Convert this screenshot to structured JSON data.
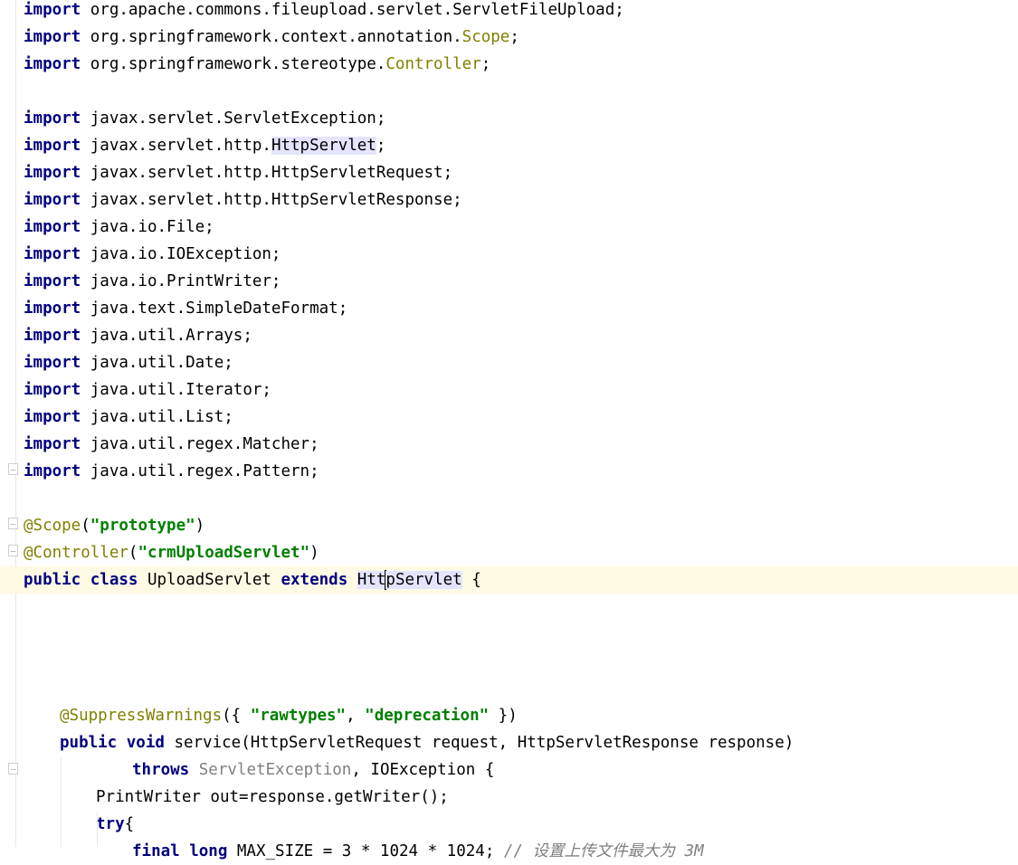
{
  "editor": {
    "language": "java",
    "lines": [
      {
        "indent": 0,
        "tokens": [
          {
            "t": "import",
            "c": "kw"
          },
          {
            "t": " org.apache.commons.fileupload.servlet.ServletFileUpload;"
          }
        ]
      },
      {
        "indent": 0,
        "tokens": [
          {
            "t": "import",
            "c": "kw"
          },
          {
            "t": " org.springframework.context.annotation."
          },
          {
            "t": "Scope",
            "c": "cls"
          },
          {
            "t": ";"
          }
        ]
      },
      {
        "indent": 0,
        "tokens": [
          {
            "t": "import",
            "c": "kw"
          },
          {
            "t": " org.springframework.stereotype."
          },
          {
            "t": "Controller",
            "c": "cls"
          },
          {
            "t": ";"
          }
        ]
      },
      {
        "indent": 0,
        "tokens": []
      },
      {
        "indent": 0,
        "tokens": [
          {
            "t": "import",
            "c": "kw"
          },
          {
            "t": " javax.servlet.ServletException;"
          }
        ]
      },
      {
        "indent": 0,
        "tokens": [
          {
            "t": "import",
            "c": "kw"
          },
          {
            "t": " javax.servlet.http."
          },
          {
            "t": "HttpServlet",
            "c": "hl"
          },
          {
            "t": ";"
          }
        ]
      },
      {
        "indent": 0,
        "tokens": [
          {
            "t": "import",
            "c": "kw"
          },
          {
            "t": " javax.servlet.http.HttpServletRequest;"
          }
        ]
      },
      {
        "indent": 0,
        "tokens": [
          {
            "t": "import",
            "c": "kw"
          },
          {
            "t": " javax.servlet.http.HttpServletResponse;"
          }
        ]
      },
      {
        "indent": 0,
        "tokens": [
          {
            "t": "import",
            "c": "kw"
          },
          {
            "t": " java.io.File;"
          }
        ]
      },
      {
        "indent": 0,
        "tokens": [
          {
            "t": "import",
            "c": "kw"
          },
          {
            "t": " java.io.IOException;"
          }
        ]
      },
      {
        "indent": 0,
        "tokens": [
          {
            "t": "import",
            "c": "kw"
          },
          {
            "t": " java.io.PrintWriter;"
          }
        ]
      },
      {
        "indent": 0,
        "tokens": [
          {
            "t": "import",
            "c": "kw"
          },
          {
            "t": " java.text.SimpleDateFormat;"
          }
        ]
      },
      {
        "indent": 0,
        "tokens": [
          {
            "t": "import",
            "c": "kw"
          },
          {
            "t": " java.util.Arrays;"
          }
        ]
      },
      {
        "indent": 0,
        "tokens": [
          {
            "t": "import",
            "c": "kw"
          },
          {
            "t": " java.util.Date;"
          }
        ]
      },
      {
        "indent": 0,
        "tokens": [
          {
            "t": "import",
            "c": "kw"
          },
          {
            "t": " java.util.Iterator;"
          }
        ]
      },
      {
        "indent": 0,
        "tokens": [
          {
            "t": "import",
            "c": "kw"
          },
          {
            "t": " java.util.List;"
          }
        ]
      },
      {
        "indent": 0,
        "tokens": [
          {
            "t": "import",
            "c": "kw"
          },
          {
            "t": " java.util.regex.Matcher;"
          }
        ]
      },
      {
        "indent": 0,
        "tokens": [
          {
            "t": "import",
            "c": "kw"
          },
          {
            "t": " java.util.regex.Pattern;"
          }
        ]
      },
      {
        "indent": 0,
        "tokens": []
      },
      {
        "indent": 0,
        "tokens": [
          {
            "t": "@Scope",
            "c": "ann"
          },
          {
            "t": "("
          },
          {
            "t": "\"prototype\"",
            "c": "str"
          },
          {
            "t": ")"
          }
        ]
      },
      {
        "indent": 0,
        "tokens": [
          {
            "t": "@Controller",
            "c": "ann"
          },
          {
            "t": "("
          },
          {
            "t": "\"crmUploadServlet\"",
            "c": "str"
          },
          {
            "t": ")"
          }
        ]
      },
      {
        "indent": 0,
        "current": true,
        "tokens": [
          {
            "t": "public class",
            "c": "kw"
          },
          {
            "t": " UploadServlet "
          },
          {
            "t": "extends",
            "c": "kw"
          },
          {
            "t": " "
          },
          {
            "t": "Htt",
            "c": "hl"
          },
          {
            "caret": true
          },
          {
            "t": "pServlet",
            "c": "hl"
          },
          {
            "t": " {"
          }
        ]
      },
      {
        "indent": 0,
        "tokens": []
      },
      {
        "indent": 0,
        "tokens": []
      },
      {
        "indent": 0,
        "tokens": []
      },
      {
        "indent": 0,
        "tokens": []
      },
      {
        "indent": 1,
        "tokens": [
          {
            "t": "@SuppressWarnings",
            "c": "ann"
          },
          {
            "t": "({ "
          },
          {
            "t": "\"rawtypes\"",
            "c": "str"
          },
          {
            "t": ", "
          },
          {
            "t": "\"deprecation\"",
            "c": "str"
          },
          {
            "t": " })"
          }
        ]
      },
      {
        "indent": 1,
        "tokens": [
          {
            "t": "public void",
            "c": "kw"
          },
          {
            "t": " service(HttpServletRequest request, HttpServletResponse response)"
          }
        ]
      },
      {
        "indent": 3,
        "tokens": [
          {
            "t": "throws",
            "c": "kw"
          },
          {
            "t": " "
          },
          {
            "t": "ServletException",
            "c": "unused"
          },
          {
            "t": ", IOException {"
          }
        ]
      },
      {
        "indent": 2,
        "tokens": [
          {
            "t": "PrintWriter out=response.getWriter();"
          }
        ]
      },
      {
        "indent": 2,
        "tokens": [
          {
            "t": "try",
            "c": "kw"
          },
          {
            "t": "{"
          }
        ]
      },
      {
        "indent": 3,
        "tokens": [
          {
            "t": "final long",
            "c": "kw"
          },
          {
            "t": " MAX_SIZE = 3 * 1024 * 1024; "
          },
          {
            "t": "// 设置上传文件最大为 3M",
            "c": "cmt"
          }
        ]
      }
    ]
  }
}
